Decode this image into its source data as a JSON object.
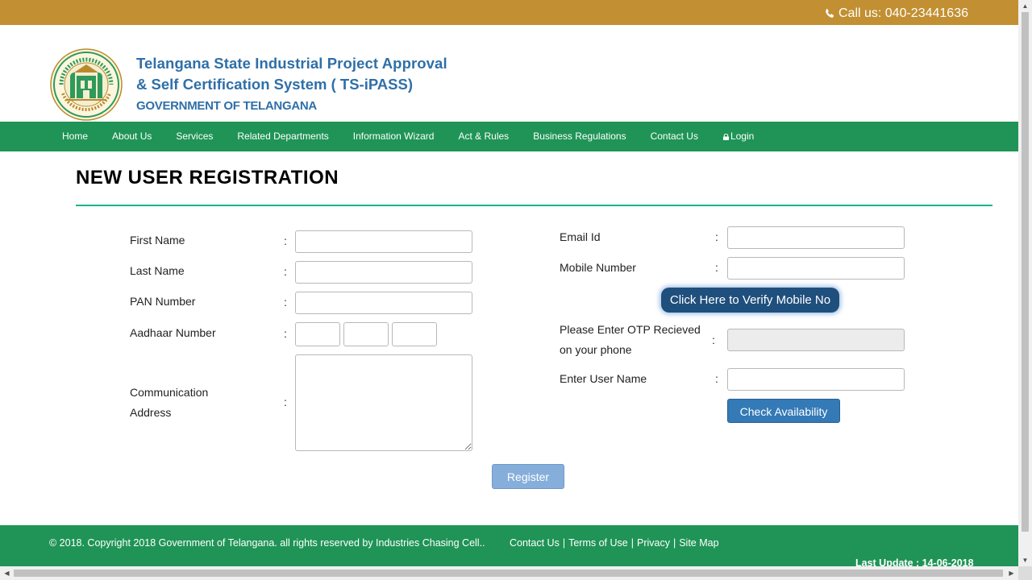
{
  "topbar": {
    "call_text": "Call us: 040-23441636",
    "icon": "phone-icon",
    "color": "#c29032"
  },
  "header": {
    "brand_line1": "Telangana State Industrial Project Approval",
    "brand_line2": "& Self Certification System ( TS-iPASS)",
    "brand_line3": "GOVERNMENT OF TELANGANA",
    "logo": "government-of-telangana-seal",
    "brand_color": "#2f6fa8"
  },
  "nav": {
    "color": "#1f9456",
    "items": [
      {
        "label": "Home"
      },
      {
        "label": "About Us"
      },
      {
        "label": "Services"
      },
      {
        "label": "Related Departments"
      },
      {
        "label": "Information Wizard"
      },
      {
        "label": "Act & Rules"
      },
      {
        "label": "Business Regulations"
      },
      {
        "label": "Contact Us"
      },
      {
        "label": "Login",
        "icon": "lock-icon"
      }
    ]
  },
  "page": {
    "title": "NEW USER REGISTRATION"
  },
  "form": {
    "first_name": {
      "label": "First Name",
      "value": ""
    },
    "last_name": {
      "label": "Last Name",
      "value": ""
    },
    "pan": {
      "label": "PAN Number",
      "value": ""
    },
    "aadhaar": {
      "label": "Aadhaar Number",
      "parts": [
        "",
        "",
        ""
      ]
    },
    "address": {
      "label_line1": "Communication",
      "label_line2": "Address",
      "value": ""
    },
    "email": {
      "label": "Email Id",
      "value": ""
    },
    "mobile": {
      "label": "Mobile Number",
      "value": ""
    },
    "verify_button": "Click Here to Verify Mobile No",
    "otp": {
      "label_line1": "Please Enter OTP Recieved",
      "label_line2": "on your phone",
      "value": ""
    },
    "username": {
      "label": "Enter User Name",
      "value": ""
    },
    "check_button": "Check Availability",
    "register_button": "Register",
    "colon": ":"
  },
  "footer": {
    "copyright": "© 2018. Copyright 2018 Government of Telangana. all rights reserved by Industries Chasing Cell..",
    "links": [
      "Contact Us",
      "Terms of Use",
      "Privacy",
      "Site Map"
    ],
    "separator": "|",
    "last_update": "Last Update : 14-06-2018"
  }
}
